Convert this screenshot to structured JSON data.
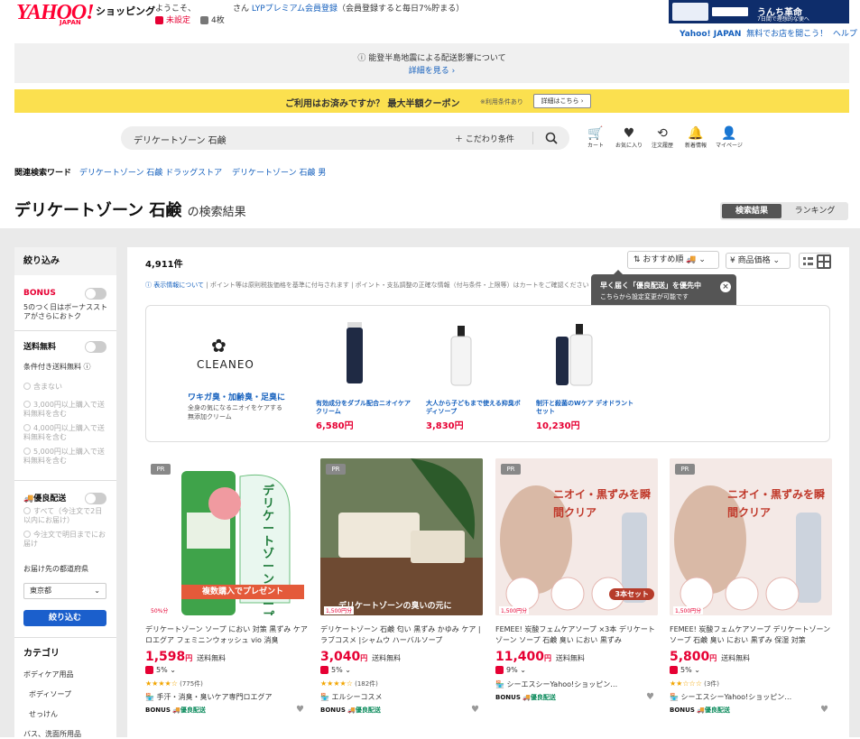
{
  "header": {
    "logo": "YAHOO!",
    "logo_sub": "JAPAN",
    "shopping": "ショッピング",
    "welcome": "ようこそ、",
    "san": "さん",
    "lyp_link": "LYPプレミアム会員登録",
    "lyp_note": "（会員登録すると毎日7%貯まる）",
    "unset": "未設定",
    "count": "4枚",
    "ad_title": "うんち革命",
    "ad_sub": "7日間で理想的な便へ",
    "links": {
      "yj": "Yahoo! JAPAN",
      "shop": "無料でお店を開こう！",
      "help": "ヘルプ"
    }
  },
  "notice": {
    "text": "能登半島地震による配送影響について",
    "link": "詳細を見る"
  },
  "coupon": {
    "text": "ご利用はお済みですか？ 最大半額クーポン",
    "note": "※利用条件あり",
    "button": "詳細はこちら"
  },
  "search": {
    "value": "デリケートゾーン 石鹸",
    "condition": "こだわり条件"
  },
  "nav_icons": [
    {
      "icon": "cart-icon",
      "label": "カート"
    },
    {
      "icon": "heart-icon",
      "label": "お気に入り"
    },
    {
      "icon": "history-icon",
      "label": "注文履歴"
    },
    {
      "icon": "bell-icon",
      "label": "新着情報"
    },
    {
      "icon": "user-icon",
      "label": "マイページ"
    }
  ],
  "related": {
    "label": "関連検索ワード",
    "items": [
      "デリケートゾーン 石鹸 ドラッグストア",
      "デリケートゾーン 石鹸 男"
    ]
  },
  "results": {
    "query": "デリケートゾーン 石鹸",
    "suffix": "の検索結果",
    "count": "4,911件",
    "tab_active": "検索結果",
    "tab_other": "ランキング"
  },
  "sort": {
    "label": "おすすめ順",
    "price": "商品価格"
  },
  "tooltip": {
    "title": "早く届く「優良配送」を優先中",
    "sub": "こちらから設定変更が可能です"
  },
  "disclaimer": {
    "link": "表示情報について",
    "text": "| ポイント等は原則税抜価格を基準に付与されます | ポイント・支払調整の正確な情報（付与条件・上限等）はカートをご確認ください"
  },
  "sidebar": {
    "title": "絞り込み",
    "bonus": "BONUS",
    "bonus_desc": "5のつく日はボーナスストアがさらにおトク",
    "free_ship": "送料無料",
    "conditional": "条件付き送料無料",
    "ship_opts": [
      "含まない",
      "3,000円以上購入で送料無料を含む",
      "4,000円以上購入で送料無料を含む",
      "5,000円以上購入で送料無料を含む"
    ],
    "yuryo": "優良配送",
    "yuryo_opts": [
      "すべて（今注文で2日以内にお届け）",
      "今注文で明日までにお届け"
    ],
    "pref_label": "お届け先の都道府県",
    "pref_value": "東京都",
    "apply": "絞り込む",
    "category": "カテゴリ",
    "cats": [
      "ボディケア用品",
      "ボディソープ",
      "せっけん",
      "バス、洗面所用品"
    ]
  },
  "brand": {
    "name": "CLEANEO",
    "title": "ワキガ臭・加齢臭・足臭に",
    "desc": "全身の気になるニオイをケアする無添加クリーム",
    "products": [
      {
        "name": "有効成分をダブル配合ニオイケアクリーム",
        "price": "6,580円"
      },
      {
        "name": "大人から子どもまで使える抑臭ボディソープ",
        "price": "3,830円"
      },
      {
        "name": "制汗と殺菌のWケア デオドラントセット",
        "price": "10,230円"
      }
    ]
  },
  "products": [
    {
      "pr": "PR",
      "name": "デリケートゾーン ソープ におい 対策 黒ずみ ケア ロエグア フェミニンウォッシュ vio 消臭",
      "price": "1,598",
      "yen": "円",
      "ship": "送料無料",
      "point": "5%",
      "rating": "(775件)",
      "stars": "★★★★☆",
      "shop": "手汗・消臭・臭いケア専門ロエグア",
      "badge": "BONUS",
      "yuryo": "優良配送",
      "ribbon": "複数購入でプレゼント",
      "pct": "50%分",
      "img_text": "デリケートゾーンソープ"
    },
    {
      "pr": "PR",
      "name": "デリケートゾーン 石鹸 匂い 黒ずみ かゆみ ケア |ラブコスメ |シャムウ ハーバルソープ",
      "price": "3,040",
      "yen": "円",
      "ship": "送料無料",
      "point": "5%",
      "rating": "(182件)",
      "stars": "★★★★☆",
      "shop": "エルシーコスメ",
      "badge": "BONUS",
      "yuryo": "優良配送",
      "ribbon": "デリケートゾーンの臭いの元に",
      "pct": "1,500円分",
      "img_text": ""
    },
    {
      "pr": "PR",
      "name": "FEMEE! 炭酸フェムケアソープ ×3本 デリケートゾーン ソープ 石鹸 臭い におい 黒ずみ",
      "price": "11,400",
      "yen": "円",
      "ship": "送料無料",
      "point": "9%",
      "rating": "",
      "stars": "",
      "shop": "シーエスシーYahoo!ショッピン…",
      "badge": "BONUS",
      "yuryo": "優良配送",
      "ribbon": "",
      "pct": "1,500円分",
      "img_text": "ニオイ・黒ずみを瞬間クリア"
    },
    {
      "pr": "PR",
      "name": "FEMEE! 炭酸フェムケアソープ デリケートゾーン ソープ 石鹸 臭い におい 黒ずみ 保湿 対策",
      "price": "5,800",
      "yen": "円",
      "ship": "送料無料",
      "point": "5%",
      "rating": "(3件)",
      "stars": "★★☆☆☆",
      "shop": "シーエスシーYahoo!ショッピン…",
      "badge": "BONUS",
      "yuryo": "優良配送",
      "ribbon": "",
      "pct": "1,500円分",
      "img_text": "ニオイ・黒ずみを瞬間クリア"
    }
  ],
  "set_badge": "3本セット"
}
